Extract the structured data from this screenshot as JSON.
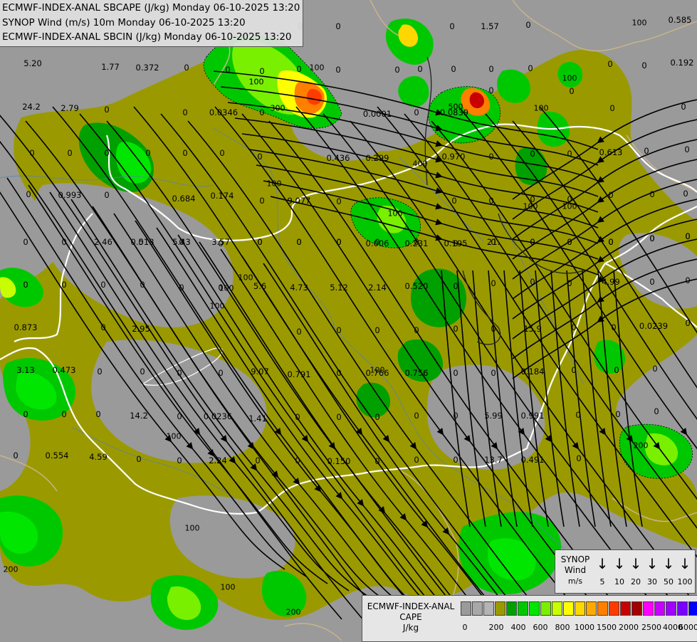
{
  "header": {
    "lines": [
      "ECMWF-INDEX-ANAL SBCAPE (J/kg) Monday 06-10-2025 13:20",
      "SYNOP Wind (m/s) 10m Monday 06-10-2025 13:20",
      "ECMWF-INDEX-ANAL SBCIN (J/kg) Monday 06-10-2025 13:20"
    ]
  },
  "map_labels": [
    "0",
    "0",
    "1.57",
    "0",
    "0.585",
    "0",
    "0",
    "0",
    "0",
    "0",
    "0",
    "5.20",
    "1.77",
    "0.372",
    "0",
    "0",
    "0",
    "0",
    "0",
    "0",
    "0",
    "0",
    "0.192",
    "0",
    "0",
    "0",
    "24.2",
    "2.79",
    "0",
    "0",
    "0.0346",
    "0",
    "0.0001",
    "0",
    "0.0839",
    "0",
    "0",
    "0",
    "0",
    "0",
    "0",
    "0",
    "0",
    "0",
    "0.436",
    "0.299",
    "0.970",
    "0",
    "0",
    "0",
    "0.613",
    "0",
    "0",
    "0",
    "0.993",
    "0",
    "0.684",
    "0.174",
    "0",
    "9.077",
    "0",
    "0",
    "0",
    "0",
    "0",
    "0",
    "0",
    "0",
    "0",
    "0",
    "2.46",
    "0.518",
    "5.43",
    "3.57",
    "0",
    "0",
    "0",
    "0.006",
    "0.231",
    "0",
    "0",
    "0",
    "0",
    "0",
    "0",
    "0",
    "0",
    "0",
    "0",
    "0",
    "0",
    "0",
    "0",
    "0",
    "0.195",
    "21.",
    "0",
    "0",
    "0",
    "0",
    "0",
    "0",
    "0",
    "0",
    "0",
    "0",
    "0",
    "5.6",
    "4.73",
    "5.12",
    "2.14",
    "0.520",
    "0",
    "0",
    "0",
    "0",
    "4.99",
    "0",
    "0",
    "0.873",
    "0",
    "2.95",
    "0",
    "0",
    "0",
    "0",
    "0",
    "0",
    "15.9",
    "0",
    "0",
    "0.0239",
    "0",
    "3.13",
    "0.473",
    "0",
    "0",
    "0",
    "0",
    "9.07",
    "0.791",
    "0",
    "0.766",
    "0.756",
    "0",
    "0",
    "0.184",
    "0",
    "0",
    "0",
    "0",
    "0",
    "0",
    "14.2",
    "0",
    "0.0236",
    "1.41",
    "0",
    "0",
    "0",
    "0",
    "0",
    "5.99",
    "0.991",
    "0",
    "0",
    "0",
    "0",
    "0.554",
    "4.59",
    "0",
    "0",
    "2.24",
    "0",
    "0",
    "0.150",
    "0",
    "0",
    "0",
    "13.7",
    "0.491",
    "0"
  ],
  "contour_labels": [
    "100",
    "100",
    "300",
    "100",
    "100",
    "100",
    "400",
    "100",
    "500",
    "100",
    "100",
    "100",
    "100",
    "100",
    "100",
    "100",
    "200",
    "200",
    "200",
    "100",
    "100",
    "100"
  ],
  "synop_legend": {
    "title_line1": "SYNOP",
    "title_line2": "Wind",
    "unit": "m/s",
    "speeds": [
      "5",
      "10",
      "20",
      "30",
      "50",
      "100"
    ],
    "arrow_glyph": "↓"
  },
  "cape_legend": {
    "title_line1": "ECMWF-INDEX-ANAL",
    "title_line2": "CAPE",
    "unit": "J/kg",
    "colors": [
      "#9a9a9a",
      "#a8a8a8",
      "#b4b4b4",
      "#9a9a00",
      "#00a000",
      "#00c800",
      "#00e600",
      "#78f000",
      "#c8ff00",
      "#ffff00",
      "#ffd700",
      "#ffaa00",
      "#ff7f00",
      "#ff3c00",
      "#c80000",
      "#a00000",
      "#ff00ff",
      "#c800ff",
      "#a000ff",
      "#7800ff",
      "#0000ff",
      "#0050ff",
      "#00b4ff",
      "#00ffff",
      "#ffffff"
    ],
    "ticks": [
      "0",
      "200",
      "400",
      "600",
      "800",
      "1000",
      "1500",
      "2000",
      "2500",
      "4000",
      "6000"
    ]
  }
}
